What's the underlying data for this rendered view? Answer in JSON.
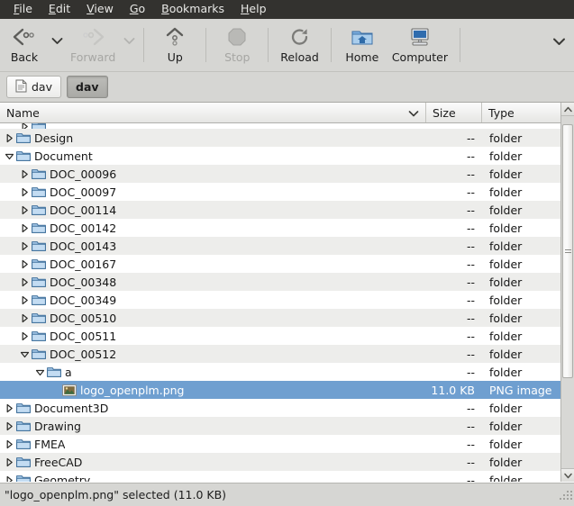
{
  "menubar": {
    "items": [
      {
        "label": "File",
        "accel": "F"
      },
      {
        "label": "Edit",
        "accel": "E"
      },
      {
        "label": "View",
        "accel": "V"
      },
      {
        "label": "Go",
        "accel": "G"
      },
      {
        "label": "Bookmarks",
        "accel": "B"
      },
      {
        "label": "Help",
        "accel": "H"
      }
    ]
  },
  "toolbar": {
    "back_label": "Back",
    "forward_label": "Forward",
    "up_label": "Up",
    "stop_label": "Stop",
    "reload_label": "Reload",
    "home_label": "Home",
    "computer_label": "Computer",
    "overflow_icon": "chevron-down-icon",
    "back_icon": "back-arrow-icon",
    "forward_icon": "forward-arrow-icon",
    "up_icon": "up-arrow-icon",
    "stop_icon": "stop-octagon-icon",
    "reload_icon": "reload-circular-arrow-icon",
    "home_icon": "home-folder-icon",
    "computer_icon": "computer-monitor-icon"
  },
  "location": {
    "crumbs": [
      {
        "label": "dav",
        "icon": "document-icon",
        "active": false
      },
      {
        "label": "dav",
        "icon": "",
        "active": true
      }
    ]
  },
  "columns": {
    "name": "Name",
    "size": "Size",
    "type": "Type",
    "sort_icon": "chevron-down-icon"
  },
  "rows": [
    {
      "label": "",
      "size": "",
      "type": "",
      "depth": 1,
      "state": "collapsed",
      "icon": "folder-icon",
      "partial": true,
      "stripe": "even"
    },
    {
      "label": "Design",
      "size": "--",
      "type": "folder",
      "depth": 0,
      "state": "collapsed",
      "icon": "folder-icon",
      "stripe": "odd"
    },
    {
      "label": "Document",
      "size": "--",
      "type": "folder",
      "depth": 0,
      "state": "expanded",
      "icon": "folder-icon",
      "stripe": "even"
    },
    {
      "label": "DOC_00096",
      "size": "--",
      "type": "folder",
      "depth": 1,
      "state": "collapsed",
      "icon": "folder-icon",
      "stripe": "odd"
    },
    {
      "label": "DOC_00097",
      "size": "--",
      "type": "folder",
      "depth": 1,
      "state": "collapsed",
      "icon": "folder-icon",
      "stripe": "even"
    },
    {
      "label": "DOC_00114",
      "size": "--",
      "type": "folder",
      "depth": 1,
      "state": "collapsed",
      "icon": "folder-icon",
      "stripe": "odd"
    },
    {
      "label": "DOC_00142",
      "size": "--",
      "type": "folder",
      "depth": 1,
      "state": "collapsed",
      "icon": "folder-icon",
      "stripe": "even"
    },
    {
      "label": "DOC_00143",
      "size": "--",
      "type": "folder",
      "depth": 1,
      "state": "collapsed",
      "icon": "folder-icon",
      "stripe": "odd"
    },
    {
      "label": "DOC_00167",
      "size": "--",
      "type": "folder",
      "depth": 1,
      "state": "collapsed",
      "icon": "folder-icon",
      "stripe": "even"
    },
    {
      "label": "DOC_00348",
      "size": "--",
      "type": "folder",
      "depth": 1,
      "state": "collapsed",
      "icon": "folder-icon",
      "stripe": "odd"
    },
    {
      "label": "DOC_00349",
      "size": "--",
      "type": "folder",
      "depth": 1,
      "state": "collapsed",
      "icon": "folder-icon",
      "stripe": "even"
    },
    {
      "label": "DOC_00510",
      "size": "--",
      "type": "folder",
      "depth": 1,
      "state": "collapsed",
      "icon": "folder-icon",
      "stripe": "odd"
    },
    {
      "label": "DOC_00511",
      "size": "--",
      "type": "folder",
      "depth": 1,
      "state": "collapsed",
      "icon": "folder-icon",
      "stripe": "even"
    },
    {
      "label": "DOC_00512",
      "size": "--",
      "type": "folder",
      "depth": 1,
      "state": "expanded",
      "icon": "folder-icon",
      "stripe": "odd"
    },
    {
      "label": "a",
      "size": "--",
      "type": "folder",
      "depth": 2,
      "state": "expanded",
      "icon": "folder-icon",
      "stripe": "even"
    },
    {
      "label": "logo_openplm.png",
      "size": "11.0 KB",
      "type": "PNG image",
      "depth": 3,
      "state": "none",
      "icon": "image-file-icon",
      "selected": true,
      "stripe": "sel"
    },
    {
      "label": "Document3D",
      "size": "--",
      "type": "folder",
      "depth": 0,
      "state": "collapsed",
      "icon": "folder-icon",
      "stripe": "even"
    },
    {
      "label": "Drawing",
      "size": "--",
      "type": "folder",
      "depth": 0,
      "state": "collapsed",
      "icon": "folder-icon",
      "stripe": "odd"
    },
    {
      "label": "FMEA",
      "size": "--",
      "type": "folder",
      "depth": 0,
      "state": "collapsed",
      "icon": "folder-icon",
      "stripe": "even"
    },
    {
      "label": "FreeCAD",
      "size": "--",
      "type": "folder",
      "depth": 0,
      "state": "collapsed",
      "icon": "folder-icon",
      "stripe": "odd"
    },
    {
      "label": "Geometry",
      "size": "--",
      "type": "folder",
      "depth": 0,
      "state": "collapsed",
      "icon": "folder-icon",
      "stripe": "even"
    }
  ],
  "scrollbar": {
    "up_icon": "scroll-up-icon",
    "down_icon": "scroll-down-icon",
    "grip_icon": "scroll-thumb-grip-icon"
  },
  "statusbar": {
    "text": "\"logo_openplm.png\" selected (11.0 KB)",
    "resize_icon": "resize-grip-icon"
  },
  "colors": {
    "menubar_bg": "#33322f",
    "toolbar_bg": "#d6d6d3",
    "selection_bg": "#6f9fd0",
    "row_alt_bg": "#ededeb",
    "folder_blue": "#7ba7d7"
  }
}
